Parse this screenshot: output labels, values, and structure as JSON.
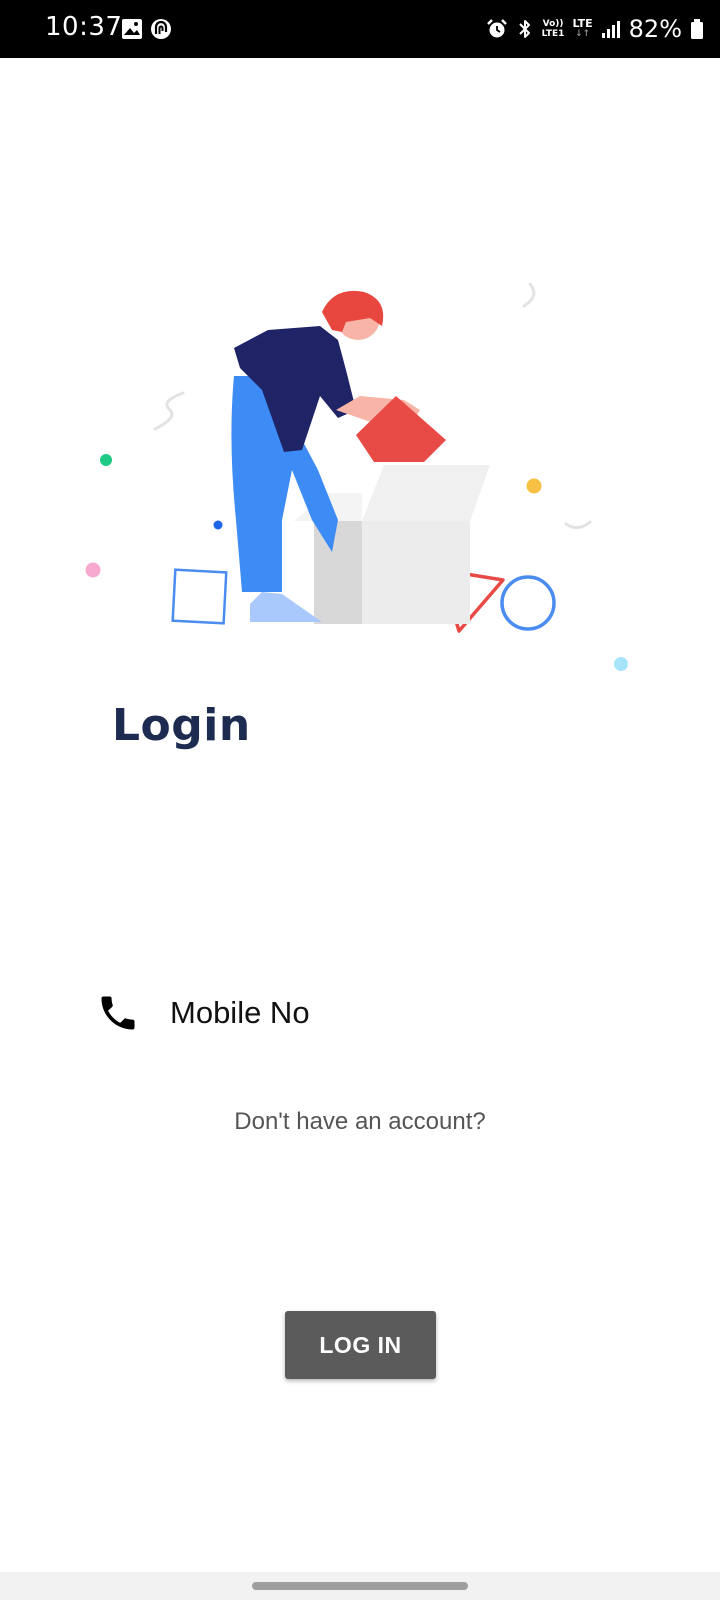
{
  "status_bar": {
    "time": "10:37",
    "left_icons": [
      "gallery-icon",
      "app-notification-icon"
    ],
    "right_icons": [
      "alarm-icon",
      "bluetooth-icon",
      "volte-icon",
      "lte-icon",
      "signal-icon",
      "battery-icon"
    ],
    "volte_label_top": "Vo))",
    "volte_label_bottom": "LTE1",
    "lte_label": "LTE",
    "battery_percent": "82%"
  },
  "illustration": {
    "name": "person-opening-box-illustration",
    "colors": {
      "hair": "#e8473f",
      "shirt": "#1f2466",
      "pants": "#3d8cf5",
      "box": "#ececec",
      "box_lid": "#e84a45",
      "shoes": "#a9c8fb"
    }
  },
  "title": "Login",
  "form": {
    "mobile_placeholder": "Mobile No"
  },
  "signup_prompt": "Don't have an account?",
  "login_button": "LOG IN",
  "colors": {
    "title": "#1c2b4f",
    "button_bg": "#5b5b5b",
    "button_text": "#ffffff"
  }
}
